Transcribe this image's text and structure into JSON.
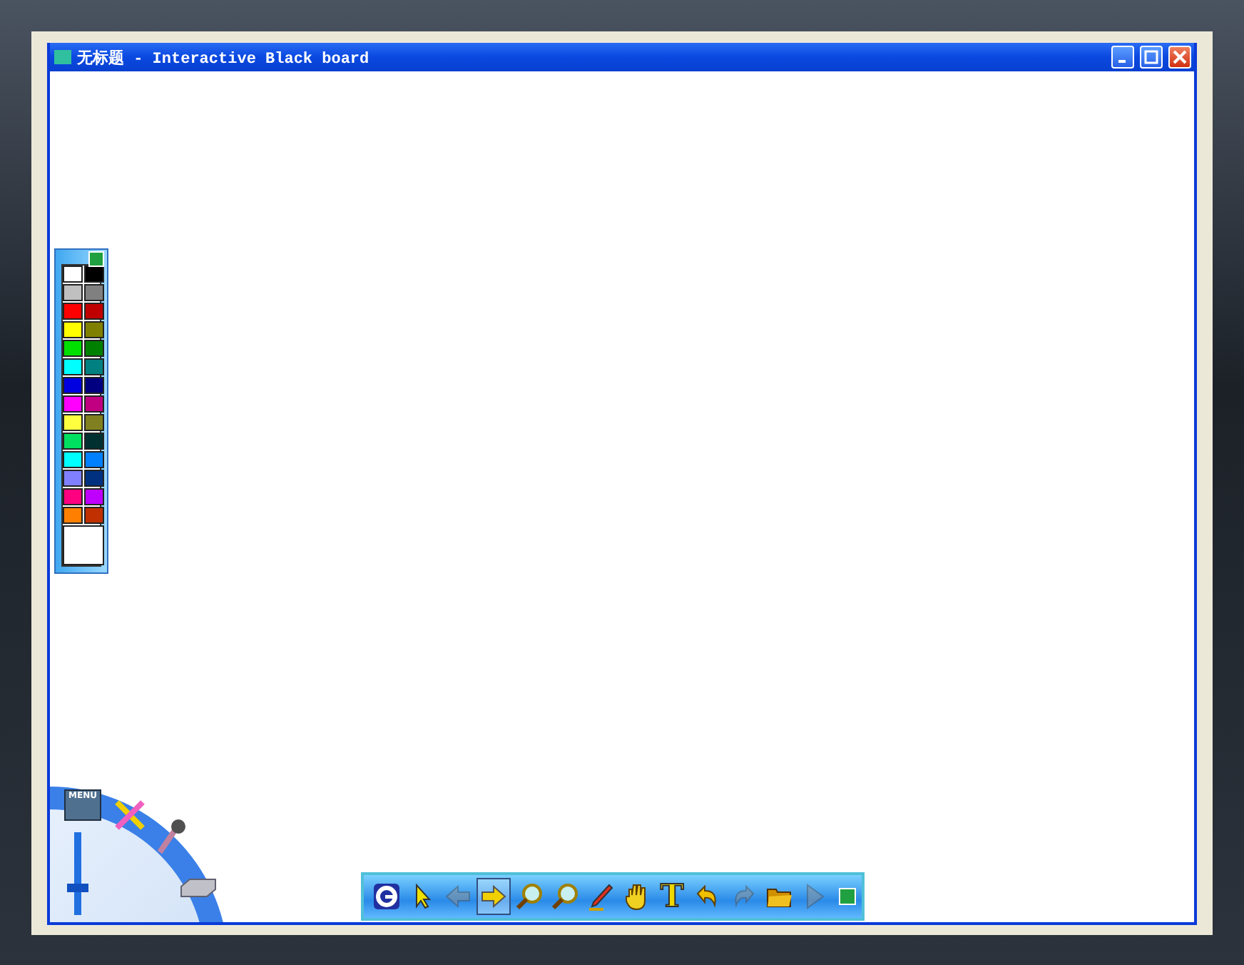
{
  "window": {
    "title": "无标题 - Interactive Black board"
  },
  "palette": {
    "colors": [
      {
        "color": "#ffffff"
      },
      {
        "color": "#000000"
      },
      {
        "color": "#c0c0c0"
      },
      {
        "color": "#808080"
      },
      {
        "color": "#ff0000"
      },
      {
        "color": "#c00000"
      },
      {
        "color": "#ffff00"
      },
      {
        "color": "#808000"
      },
      {
        "color": "#00e000"
      },
      {
        "color": "#008000"
      },
      {
        "color": "#00ffff"
      },
      {
        "color": "#008080"
      },
      {
        "color": "#0000e0"
      },
      {
        "color": "#000080"
      },
      {
        "color": "#ff00ff"
      },
      {
        "color": "#c00080"
      },
      {
        "color": "#ffff40"
      },
      {
        "color": "#808020"
      },
      {
        "color": "#00e060"
      },
      {
        "color": "#003030"
      },
      {
        "color": "#00ffff"
      },
      {
        "color": "#0080ff"
      },
      {
        "color": "#8080ff"
      },
      {
        "color": "#003080"
      },
      {
        "color": "#ff0080"
      },
      {
        "color": "#c000ff"
      },
      {
        "color": "#ff8000"
      },
      {
        "color": "#c03000"
      }
    ]
  },
  "dial": {
    "menu_label": "MENU",
    "slider": {
      "level": 0.3
    }
  },
  "toolbar": {
    "tools": [
      {
        "kind": "logo",
        "selected": false,
        "disabled": false
      },
      {
        "kind": "pointer",
        "selected": false,
        "disabled": false
      },
      {
        "kind": "back",
        "selected": false,
        "disabled": true
      },
      {
        "kind": "forward",
        "selected": true,
        "disabled": false
      },
      {
        "kind": "zoom-in",
        "selected": false,
        "disabled": false
      },
      {
        "kind": "zoom-out",
        "selected": false,
        "disabled": false
      },
      {
        "kind": "pen",
        "selected": false,
        "disabled": false
      },
      {
        "kind": "hand",
        "selected": false,
        "disabled": false
      },
      {
        "kind": "text",
        "label": "T",
        "selected": false,
        "disabled": false
      },
      {
        "kind": "undo",
        "selected": false,
        "disabled": false
      },
      {
        "kind": "redo",
        "selected": false,
        "disabled": true
      },
      {
        "kind": "folder",
        "selected": false,
        "disabled": false
      },
      {
        "kind": "next",
        "selected": false,
        "disabled": true
      }
    ]
  }
}
